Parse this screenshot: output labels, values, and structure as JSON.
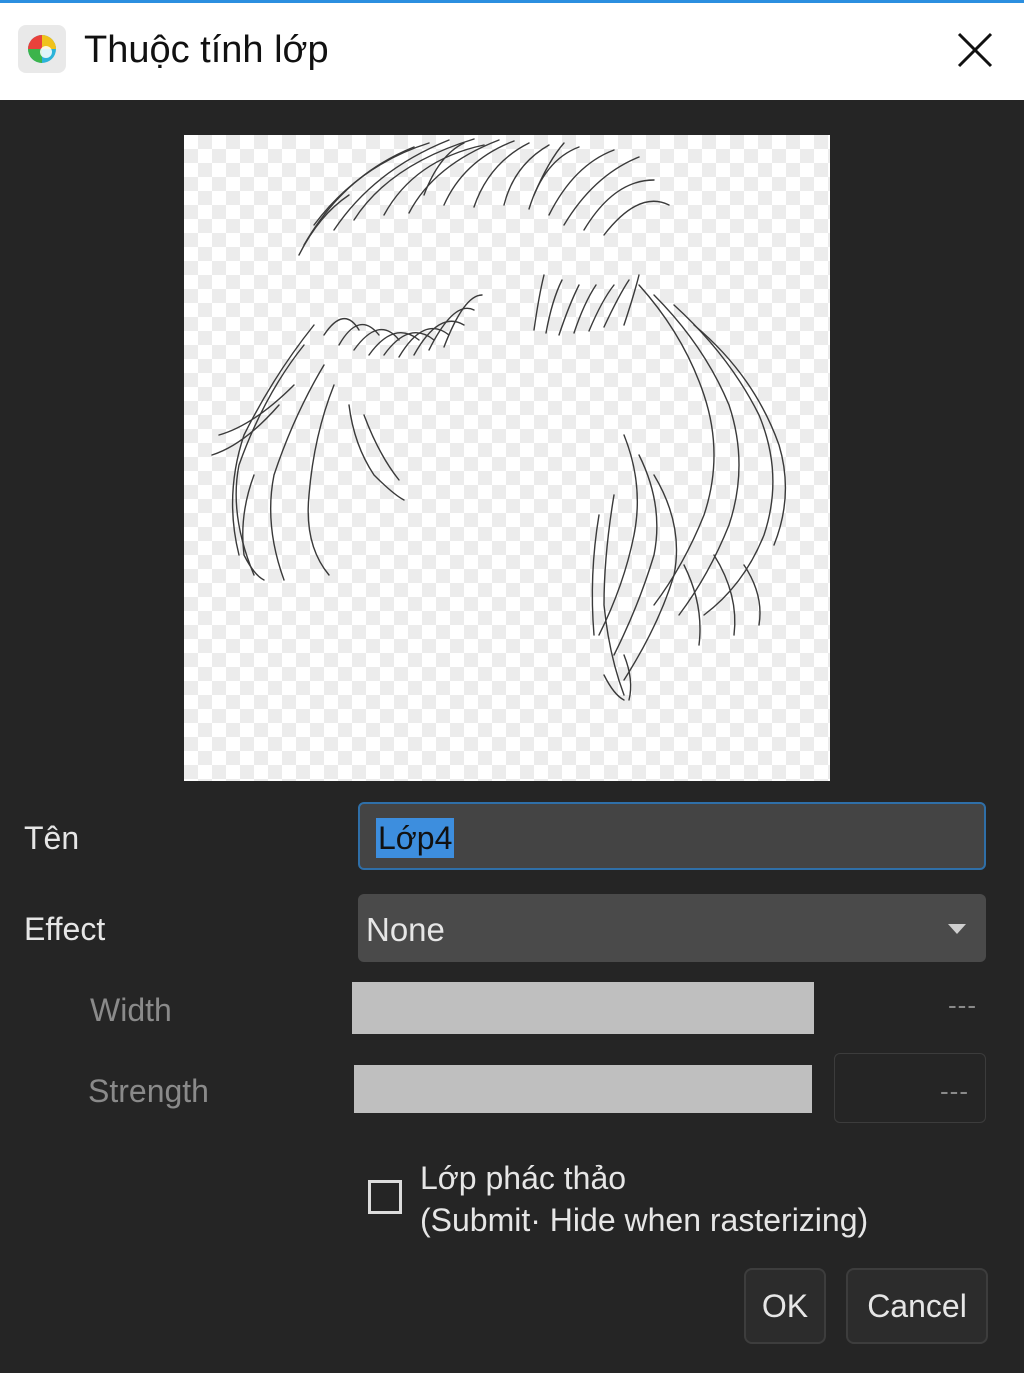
{
  "window": {
    "title": "Thuộc tính lớp",
    "accent": "#2b8fe0"
  },
  "form": {
    "name_label": "Tên",
    "name_value": "Lớp4",
    "effect_label": "Effect",
    "effect_value": "None",
    "width_label": "Width",
    "width_value": "---",
    "strength_label": "Strength",
    "strength_value": "---",
    "draft_label_line1": "Lớp phác thảo",
    "draft_label_line2": "(Submit· Hide when rasterizing)",
    "draft_checked": false
  },
  "buttons": {
    "ok": "OK",
    "cancel": "Cancel"
  },
  "icons": {
    "app": "medibang-logo-icon",
    "close": "close-icon",
    "dropdown": "chevron-down-icon"
  }
}
